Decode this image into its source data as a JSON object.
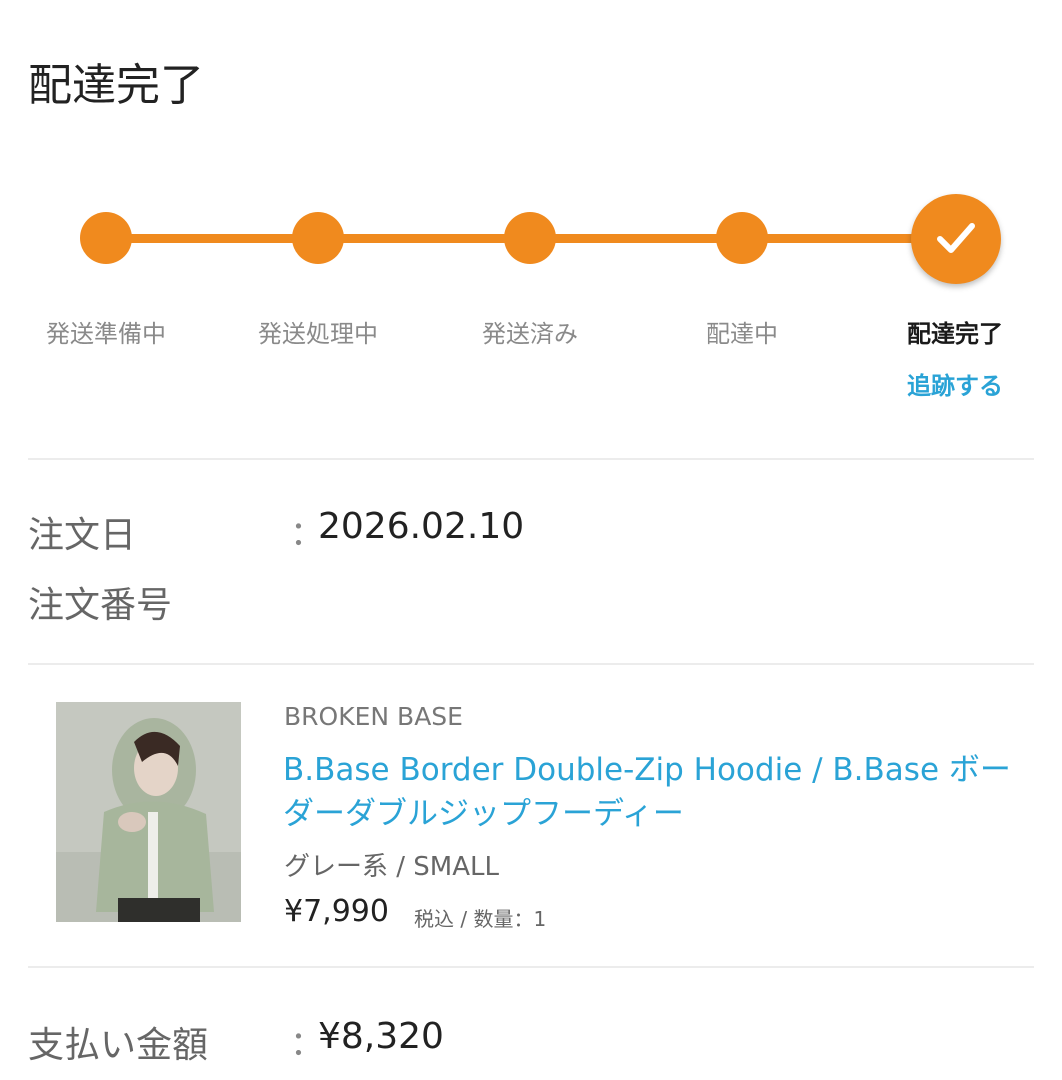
{
  "header": {
    "title": "配達完了"
  },
  "progress": {
    "steps": [
      {
        "label": "発送準備中"
      },
      {
        "label": "発送処理中"
      },
      {
        "label": "発送済み"
      },
      {
        "label": "配達中"
      },
      {
        "label": "配達完了"
      }
    ],
    "current_step": 5,
    "track_link_label": "追跡する",
    "accent_color": "#f08a1e",
    "link_color": "#2aa3d6"
  },
  "order": {
    "date_label": "注文日",
    "date_value": "2026.02.10",
    "number_label": "注文番号",
    "separator": "："
  },
  "product": {
    "brand": "BROKEN BASE",
    "name": "B.Base Border Double-Zip Hoodie / B.Base ボーダーダブルジップフーディー",
    "variant": "グレー系 / SMALL",
    "price": "¥7,990",
    "price_meta": "税込 / 数量：1"
  },
  "payment": {
    "label": "支払い金額",
    "value": "¥8,320"
  }
}
